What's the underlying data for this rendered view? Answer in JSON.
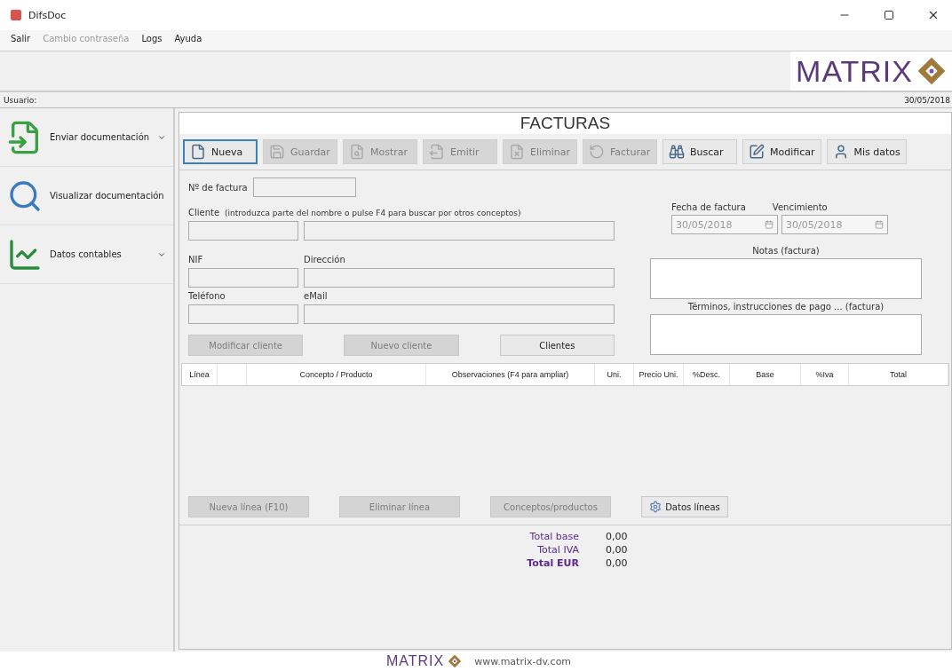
{
  "window": {
    "title": "DifsDoc"
  },
  "menu": [
    {
      "label": "Salir",
      "disabled": false
    },
    {
      "label": "Cambio contraseña",
      "disabled": true
    },
    {
      "label": "Logs",
      "disabled": false
    },
    {
      "label": "Ayuda",
      "disabled": false
    }
  ],
  "banner": {
    "logo": "MATRIX"
  },
  "user_bar": {
    "label": "Usuario:",
    "date": "30/05/2018"
  },
  "sidebar": {
    "items": [
      {
        "label": "Enviar documentación",
        "has_menu": true
      },
      {
        "label": "Visualizar documentación",
        "has_menu": false
      },
      {
        "label": "Datos contables",
        "has_menu": true
      }
    ]
  },
  "panel": {
    "title": "FACTURAS"
  },
  "toolbar": [
    {
      "label": "Nueva",
      "disabled": false,
      "selected": true
    },
    {
      "label": "Guardar",
      "disabled": true,
      "selected": false
    },
    {
      "label": "Mostrar",
      "disabled": true,
      "selected": false
    },
    {
      "label": "Emitir",
      "disabled": true,
      "selected": false
    },
    {
      "label": "Eliminar",
      "disabled": true,
      "selected": false
    },
    {
      "label": "Facturar",
      "disabled": true,
      "selected": false
    },
    {
      "label": "Buscar",
      "disabled": false,
      "selected": false
    },
    {
      "label": "Modificar",
      "disabled": false,
      "selected": false
    },
    {
      "label": "Mis datos",
      "disabled": false,
      "selected": false
    }
  ],
  "form": {
    "invoice_number_label": "Nº de factura",
    "client_label": "Cliente",
    "client_hint": "(introduzca parte del nombre o pulse F4 para buscar por otros conceptos)",
    "nif_label": "NIF",
    "address_label": "Dirección",
    "phone_label": "Teléfono",
    "email_label": "eMail",
    "invoice_date_label": "Fecha de factura",
    "invoice_date": "30/05/2018",
    "due_date_label": "Vencimiento",
    "due_date": "30/05/2018",
    "notes_label": "Notas (factura)",
    "terms_label": "Términos, instrucciones de pago ... (factura)"
  },
  "client_buttons": [
    {
      "label": "Modificar cliente",
      "disabled": true
    },
    {
      "label": "Nuevo cliente",
      "disabled": true
    },
    {
      "label": "Clientes",
      "disabled": false
    }
  ],
  "table": {
    "columns": [
      "Línea",
      "Concepto / Producto",
      "Observaciones (F4 para ampliar)",
      "Uni.",
      "Precio Uni.",
      "%Desc.",
      "Base",
      "%Iva",
      "Total"
    ]
  },
  "line_buttons": [
    {
      "label": "Nueva línea (F10)",
      "disabled": true
    },
    {
      "label": "Eliminar línea",
      "disabled": true
    },
    {
      "label": "Conceptos/productos",
      "disabled": true
    },
    {
      "label": "Datos líneas",
      "disabled": false
    }
  ],
  "totals": [
    {
      "label": "Total base",
      "value": "0,00",
      "emphasis": false
    },
    {
      "label": "Total IVA",
      "value": "0,00",
      "emphasis": false
    },
    {
      "label": "Total EUR",
      "value": "0,00",
      "emphasis": true
    }
  ],
  "footer": {
    "logo": "MATRIX",
    "url": "www.matrix-dv.com"
  }
}
